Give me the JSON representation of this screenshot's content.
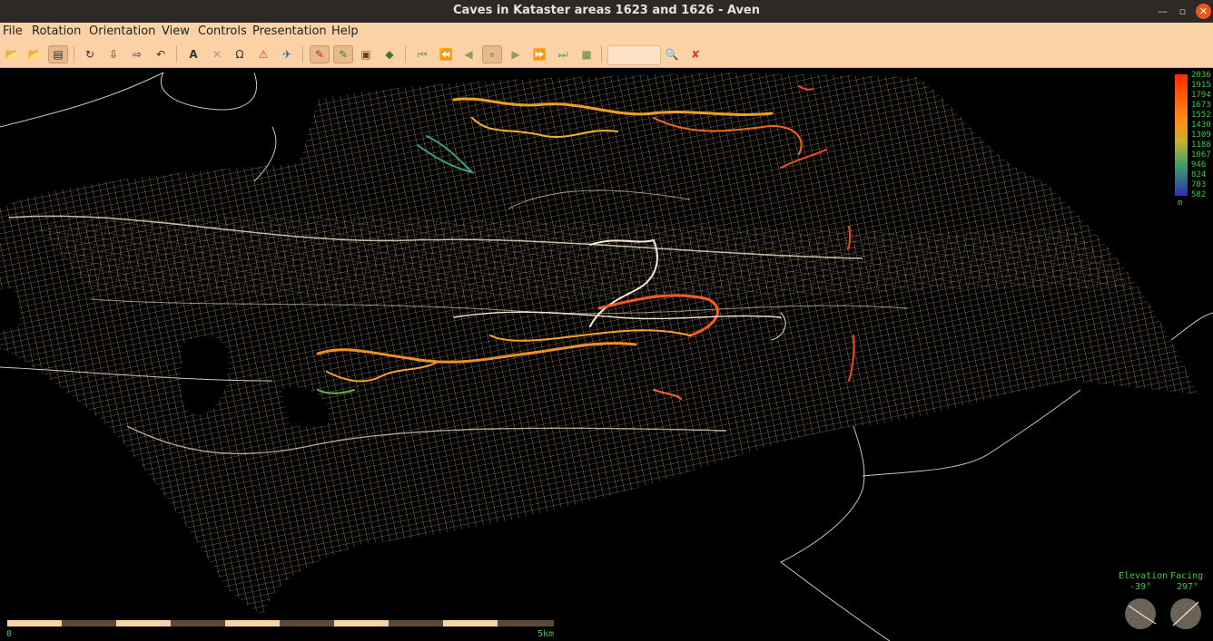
{
  "window": {
    "title": "Caves in Kataster areas 1623 and 1626 - Aven"
  },
  "menu": [
    "File",
    "Rotation",
    "Orientation",
    "View",
    "Controls",
    "Presentation",
    "Help"
  ],
  "toolbar": {
    "buttons": [
      {
        "icon": "open-icon",
        "glyph": "📂"
      },
      {
        "icon": "open-terrain-icon",
        "glyph": "📂"
      },
      {
        "icon": "print-icon",
        "glyph": "▤"
      },
      {
        "icon": "rotate-icon",
        "glyph": "↻"
      },
      {
        "icon": "move-down-icon",
        "glyph": "⇩"
      },
      {
        "icon": "move-right-icon",
        "glyph": "⇨"
      },
      {
        "icon": "undo-icon",
        "glyph": "↶"
      },
      {
        "icon": "survey-legs-icon",
        "glyph": "A"
      },
      {
        "icon": "crosses-icon",
        "glyph": "✕"
      },
      {
        "icon": "entrances-icon",
        "glyph": "Ω"
      },
      {
        "icon": "fixed-points-icon",
        "glyph": "⚠"
      },
      {
        "icon": "exported-points-icon",
        "glyph": "✈"
      },
      {
        "icon": "underground-legs-icon",
        "glyph": "✎"
      },
      {
        "icon": "surface-legs-icon",
        "glyph": "✎"
      },
      {
        "icon": "tubes-icon",
        "glyph": "▣"
      },
      {
        "icon": "terrain-icon",
        "glyph": "◆"
      },
      {
        "icon": "skip-start-icon",
        "glyph": "⏮"
      },
      {
        "icon": "fast-back-icon",
        "glyph": "⏪"
      },
      {
        "icon": "play-back-icon",
        "glyph": "◀"
      },
      {
        "icon": "pause-icon",
        "glyph": "⏸"
      },
      {
        "icon": "play-icon",
        "glyph": "▶"
      },
      {
        "icon": "fast-forward-icon",
        "glyph": "⏩"
      },
      {
        "icon": "skip-end-icon",
        "glyph": "⏭"
      },
      {
        "icon": "stop-icon",
        "glyph": "■"
      },
      {
        "icon": "find-icon",
        "glyph": "🔍"
      },
      {
        "icon": "hide-found-icon",
        "glyph": "✘"
      }
    ],
    "search_value": ""
  },
  "legend": {
    "values": [
      "2036",
      "1915",
      "1794",
      "1673",
      "1552",
      "1430",
      "1309",
      "1188",
      "1067",
      "946",
      "824",
      "703",
      "582"
    ],
    "unit": "m",
    "colors": [
      "#ff2b00",
      "#ff4a00",
      "#ff6a00",
      "#ff8a10",
      "#ff9f2a",
      "#e0a020",
      "#b8b030",
      "#7cb048",
      "#3e9f6a",
      "#2f8a8a",
      "#2f6ea8",
      "#2f4eb8",
      "#3030b0"
    ]
  },
  "scalebar": {
    "start": "0",
    "end": "5km"
  },
  "orientation": {
    "elevation_label": "Elevation",
    "elevation_value": "-39°",
    "facing_label": "Facing",
    "facing_value": "297°"
  },
  "colors": {
    "menu_bg": "#fbd2a6",
    "mesh": "#f4d7b0"
  }
}
